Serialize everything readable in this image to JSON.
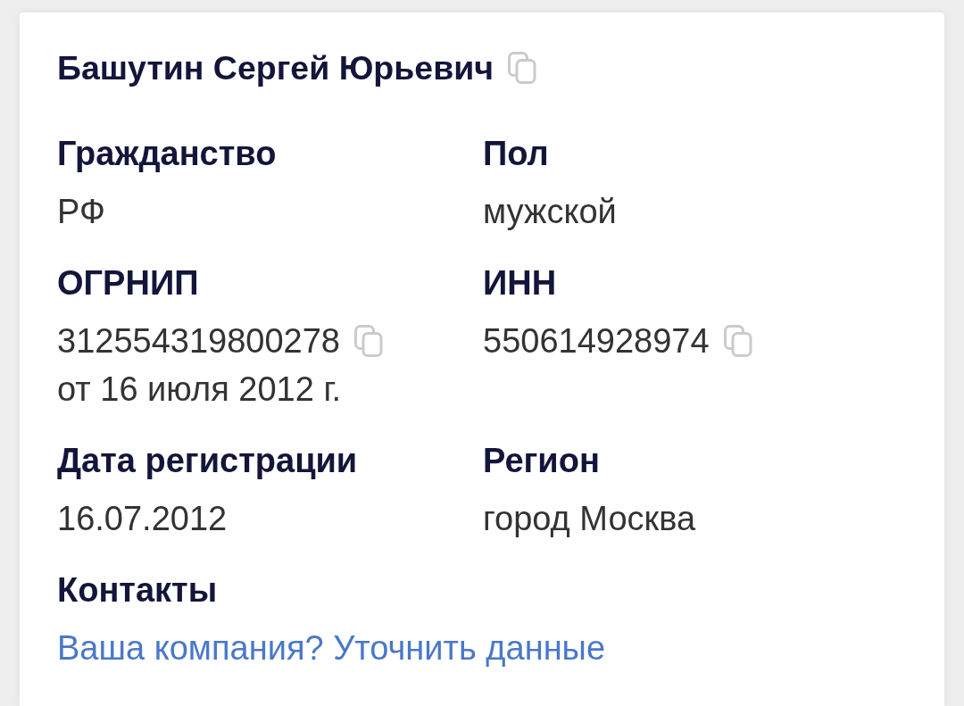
{
  "title": {
    "text": "Башутин Сергей Юрьевич",
    "copyable": true
  },
  "fields": [
    {
      "label": "Гражданство",
      "values": [
        {
          "text": "РФ",
          "copyable": false
        }
      ]
    },
    {
      "label": "Пол",
      "values": [
        {
          "text": "мужской",
          "copyable": false
        }
      ]
    },
    {
      "label": "ОГРНИП",
      "values": [
        {
          "text": "312554319800278",
          "copyable": true
        },
        {
          "text": "от 16 июля 2012 г.",
          "copyable": false
        }
      ]
    },
    {
      "label": "ИНН",
      "values": [
        {
          "text": "550614928974",
          "copyable": true
        }
      ]
    },
    {
      "label": "Дата регистрации",
      "values": [
        {
          "text": "16.07.2012",
          "copyable": false
        }
      ]
    },
    {
      "label": "Регион",
      "values": [
        {
          "text": "город Москва",
          "copyable": false
        }
      ]
    }
  ],
  "contacts": {
    "label": "Контакты",
    "link": "Ваша компания? Уточнить данные"
  }
}
